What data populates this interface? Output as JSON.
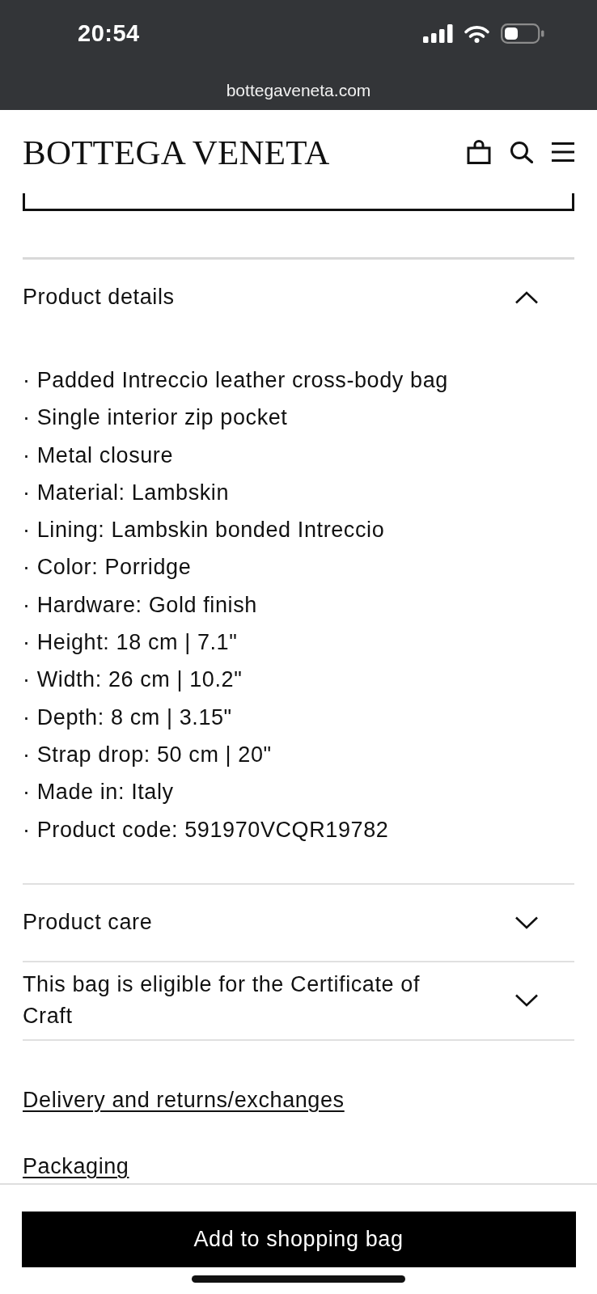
{
  "status_bar": {
    "time": "20:54",
    "url": "bottegaveneta.com"
  },
  "header": {
    "logo": "BOTTEGA VENETA"
  },
  "sections": [
    {
      "title": "Product details",
      "expanded": true,
      "items": [
        "· Padded Intreccio leather cross-body bag",
        "· Single interior zip pocket",
        "· Metal closure",
        "· Material: Lambskin",
        "· Lining: Lambskin bonded Intreccio",
        "· Color: Porridge",
        "· Hardware: Gold finish",
        "· Height: 18 cm | 7.1\"",
        "· Width: 26 cm | 10.2\"",
        "· Depth: 8 cm | 3.15\"",
        "· Strap drop: 50 cm | 20\"",
        "· Made in: Italy",
        "· Product code: 591970VCQR19782"
      ]
    },
    {
      "title": "Product care",
      "expanded": false
    },
    {
      "title": "This bag is eligible for the Certificate of Craft",
      "expanded": false
    }
  ],
  "links": [
    "Delivery and returns/exchanges",
    "Packaging"
  ],
  "add_button": {
    "label": "Add to shopping bag"
  }
}
